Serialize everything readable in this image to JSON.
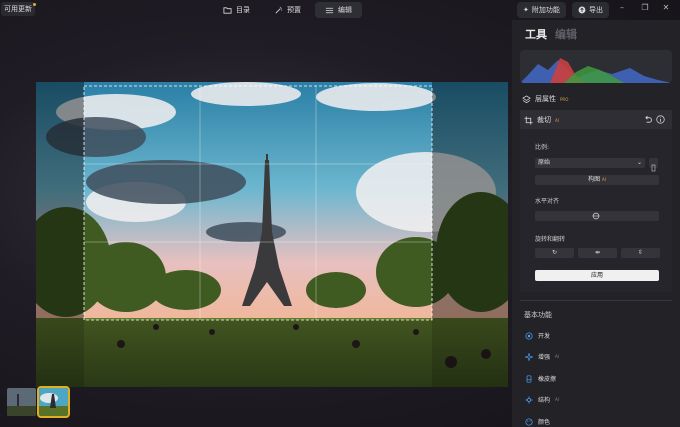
{
  "topbar": {
    "update_label": "可用更新",
    "tabs": [
      {
        "label": "目录",
        "icon": "folder-icon"
      },
      {
        "label": "预置",
        "icon": "magic-wand-icon"
      },
      {
        "label": "编辑",
        "icon": "sliders-icon",
        "active": true
      }
    ],
    "addon_label": "附加功能",
    "export_label": "导出",
    "window": {
      "minimize": "–",
      "maximize": "❐",
      "close": "✕"
    }
  },
  "panel": {
    "tab_tools": "工具",
    "tab_edit": "编辑",
    "layers_label": "层属性",
    "layers_badge": "PRO",
    "crop_label": "裁切",
    "crop_badge": "AI",
    "ratio_label": "比例:",
    "ratio_value": "原始",
    "composition_label": "构图",
    "composition_badge": "AI",
    "level_label": "水平对齐",
    "rotate_label": "旋转和翻转",
    "apply_label": "应用",
    "basic_section": "基本功能",
    "features": [
      {
        "label": "开发",
        "icon": "aperture-icon",
        "badge": ""
      },
      {
        "label": "增强",
        "icon": "sparkle-icon",
        "badge": "AI"
      },
      {
        "label": "橡皮擦",
        "icon": "eraser-icon",
        "badge": ""
      },
      {
        "label": "结构",
        "icon": "structure-icon",
        "badge": "AI"
      },
      {
        "label": "颜色",
        "icon": "palette-icon",
        "badge": ""
      }
    ]
  },
  "colors": {
    "accent": "#e0b020",
    "apply_bg": "#f0f0f0",
    "panel_bg": "#232227"
  }
}
